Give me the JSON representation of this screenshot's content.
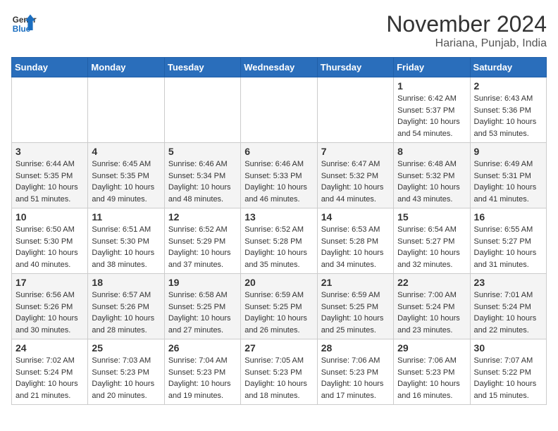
{
  "logo": {
    "general": "General",
    "blue": "Blue"
  },
  "title": "November 2024",
  "location": "Hariana, Punjab, India",
  "days_of_week": [
    "Sunday",
    "Monday",
    "Tuesday",
    "Wednesday",
    "Thursday",
    "Friday",
    "Saturday"
  ],
  "weeks": [
    [
      {
        "day": "",
        "info": ""
      },
      {
        "day": "",
        "info": ""
      },
      {
        "day": "",
        "info": ""
      },
      {
        "day": "",
        "info": ""
      },
      {
        "day": "",
        "info": ""
      },
      {
        "day": "1",
        "info": "Sunrise: 6:42 AM\nSunset: 5:37 PM\nDaylight: 10 hours and 54 minutes."
      },
      {
        "day": "2",
        "info": "Sunrise: 6:43 AM\nSunset: 5:36 PM\nDaylight: 10 hours and 53 minutes."
      }
    ],
    [
      {
        "day": "3",
        "info": "Sunrise: 6:44 AM\nSunset: 5:35 PM\nDaylight: 10 hours and 51 minutes."
      },
      {
        "day": "4",
        "info": "Sunrise: 6:45 AM\nSunset: 5:35 PM\nDaylight: 10 hours and 49 minutes."
      },
      {
        "day": "5",
        "info": "Sunrise: 6:46 AM\nSunset: 5:34 PM\nDaylight: 10 hours and 48 minutes."
      },
      {
        "day": "6",
        "info": "Sunrise: 6:46 AM\nSunset: 5:33 PM\nDaylight: 10 hours and 46 minutes."
      },
      {
        "day": "7",
        "info": "Sunrise: 6:47 AM\nSunset: 5:32 PM\nDaylight: 10 hours and 44 minutes."
      },
      {
        "day": "8",
        "info": "Sunrise: 6:48 AM\nSunset: 5:32 PM\nDaylight: 10 hours and 43 minutes."
      },
      {
        "day": "9",
        "info": "Sunrise: 6:49 AM\nSunset: 5:31 PM\nDaylight: 10 hours and 41 minutes."
      }
    ],
    [
      {
        "day": "10",
        "info": "Sunrise: 6:50 AM\nSunset: 5:30 PM\nDaylight: 10 hours and 40 minutes."
      },
      {
        "day": "11",
        "info": "Sunrise: 6:51 AM\nSunset: 5:30 PM\nDaylight: 10 hours and 38 minutes."
      },
      {
        "day": "12",
        "info": "Sunrise: 6:52 AM\nSunset: 5:29 PM\nDaylight: 10 hours and 37 minutes."
      },
      {
        "day": "13",
        "info": "Sunrise: 6:52 AM\nSunset: 5:28 PM\nDaylight: 10 hours and 35 minutes."
      },
      {
        "day": "14",
        "info": "Sunrise: 6:53 AM\nSunset: 5:28 PM\nDaylight: 10 hours and 34 minutes."
      },
      {
        "day": "15",
        "info": "Sunrise: 6:54 AM\nSunset: 5:27 PM\nDaylight: 10 hours and 32 minutes."
      },
      {
        "day": "16",
        "info": "Sunrise: 6:55 AM\nSunset: 5:27 PM\nDaylight: 10 hours and 31 minutes."
      }
    ],
    [
      {
        "day": "17",
        "info": "Sunrise: 6:56 AM\nSunset: 5:26 PM\nDaylight: 10 hours and 30 minutes."
      },
      {
        "day": "18",
        "info": "Sunrise: 6:57 AM\nSunset: 5:26 PM\nDaylight: 10 hours and 28 minutes."
      },
      {
        "day": "19",
        "info": "Sunrise: 6:58 AM\nSunset: 5:25 PM\nDaylight: 10 hours and 27 minutes."
      },
      {
        "day": "20",
        "info": "Sunrise: 6:59 AM\nSunset: 5:25 PM\nDaylight: 10 hours and 26 minutes."
      },
      {
        "day": "21",
        "info": "Sunrise: 6:59 AM\nSunset: 5:25 PM\nDaylight: 10 hours and 25 minutes."
      },
      {
        "day": "22",
        "info": "Sunrise: 7:00 AM\nSunset: 5:24 PM\nDaylight: 10 hours and 23 minutes."
      },
      {
        "day": "23",
        "info": "Sunrise: 7:01 AM\nSunset: 5:24 PM\nDaylight: 10 hours and 22 minutes."
      }
    ],
    [
      {
        "day": "24",
        "info": "Sunrise: 7:02 AM\nSunset: 5:24 PM\nDaylight: 10 hours and 21 minutes."
      },
      {
        "day": "25",
        "info": "Sunrise: 7:03 AM\nSunset: 5:23 PM\nDaylight: 10 hours and 20 minutes."
      },
      {
        "day": "26",
        "info": "Sunrise: 7:04 AM\nSunset: 5:23 PM\nDaylight: 10 hours and 19 minutes."
      },
      {
        "day": "27",
        "info": "Sunrise: 7:05 AM\nSunset: 5:23 PM\nDaylight: 10 hours and 18 minutes."
      },
      {
        "day": "28",
        "info": "Sunrise: 7:06 AM\nSunset: 5:23 PM\nDaylight: 10 hours and 17 minutes."
      },
      {
        "day": "29",
        "info": "Sunrise: 7:06 AM\nSunset: 5:23 PM\nDaylight: 10 hours and 16 minutes."
      },
      {
        "day": "30",
        "info": "Sunrise: 7:07 AM\nSunset: 5:22 PM\nDaylight: 10 hours and 15 minutes."
      }
    ]
  ]
}
